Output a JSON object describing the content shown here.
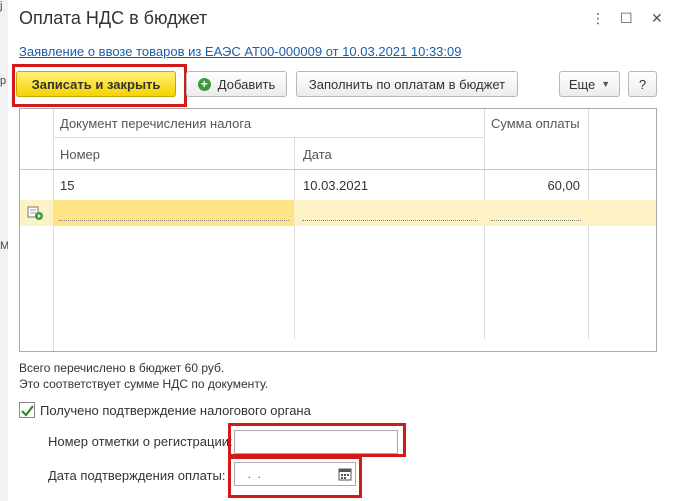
{
  "window": {
    "title": "Оплата НДС в бюджет",
    "link": "Заявление о ввозе товаров из ЕАЭС АТ00-000009 от 10.03.2021 10:33:09",
    "controls": {
      "more": "⋮",
      "maximize": "☐",
      "close": "✕"
    }
  },
  "toolbar": {
    "save_close": "Записать и закрыть",
    "add": "Добавить",
    "fill": "Заполнить по оплатам в бюджет",
    "more": "Еще",
    "help": "?"
  },
  "table": {
    "group_header": "Документ перечисления налога",
    "col_number": "Номер",
    "col_date": "Дата",
    "col_sum": "Сумма оплаты",
    "rows": [
      {
        "number": "15",
        "date": "10.03.2021",
        "sum": "60,00"
      }
    ]
  },
  "info": {
    "line1": "Всего перечислено в бюджет 60 руб.",
    "line2": "Это соответствует сумме НДС по документу."
  },
  "form": {
    "confirmed_label": "Получено подтверждение налогового органа",
    "reg_number_label": "Номер отметки о регистрации:",
    "reg_number_value": "",
    "pay_date_label": "Дата подтверждения оплаты:",
    "pay_date_value": "  .  .    "
  },
  "colors": {
    "accent_red": "#d31a1a",
    "primary_yellow": "#f5d300",
    "link_blue": "#1a5ea8",
    "new_row": "#fdf1c6"
  },
  "icons": {
    "add": "plus-circle-icon",
    "new_row": "new-row-icon",
    "calendar": "calendar-icon",
    "check": "check-icon"
  }
}
